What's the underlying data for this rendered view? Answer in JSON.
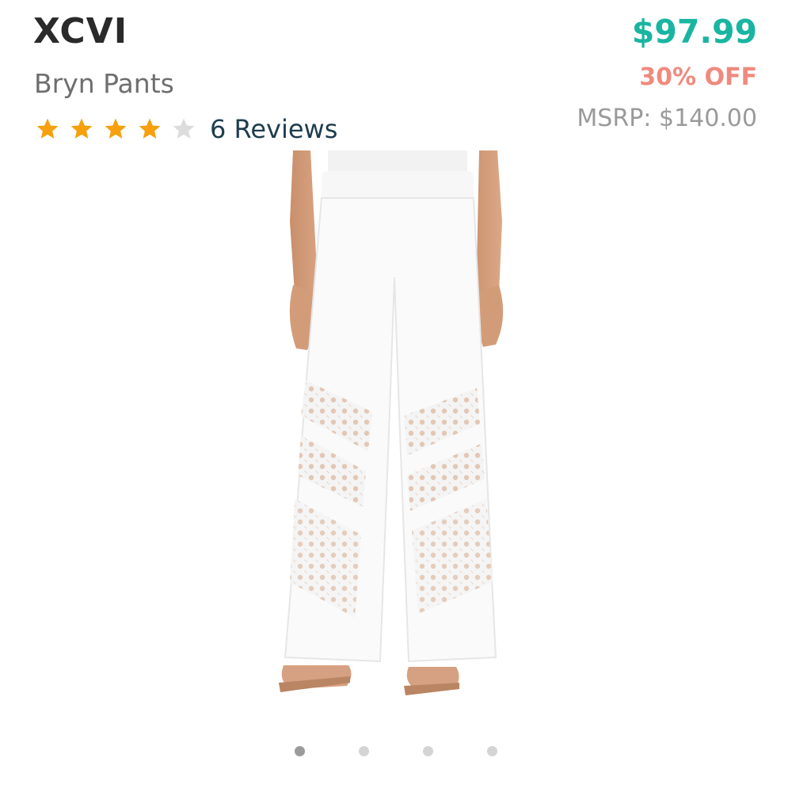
{
  "product": {
    "brand": "XCVI",
    "name": "Bryn Pants",
    "rating": 4,
    "rating_max": 5,
    "reviews_label": "6 Reviews"
  },
  "pricing": {
    "price": "$97.99",
    "discount": "30% OFF",
    "msrp": "MSRP: $140.00"
  },
  "colors": {
    "price": "#19b5a1",
    "discount": "#f08a7e",
    "star_filled": "#f5a00c",
    "star_empty": "#dcdcdc"
  },
  "carousel": {
    "count": 4,
    "active_index": 0
  }
}
